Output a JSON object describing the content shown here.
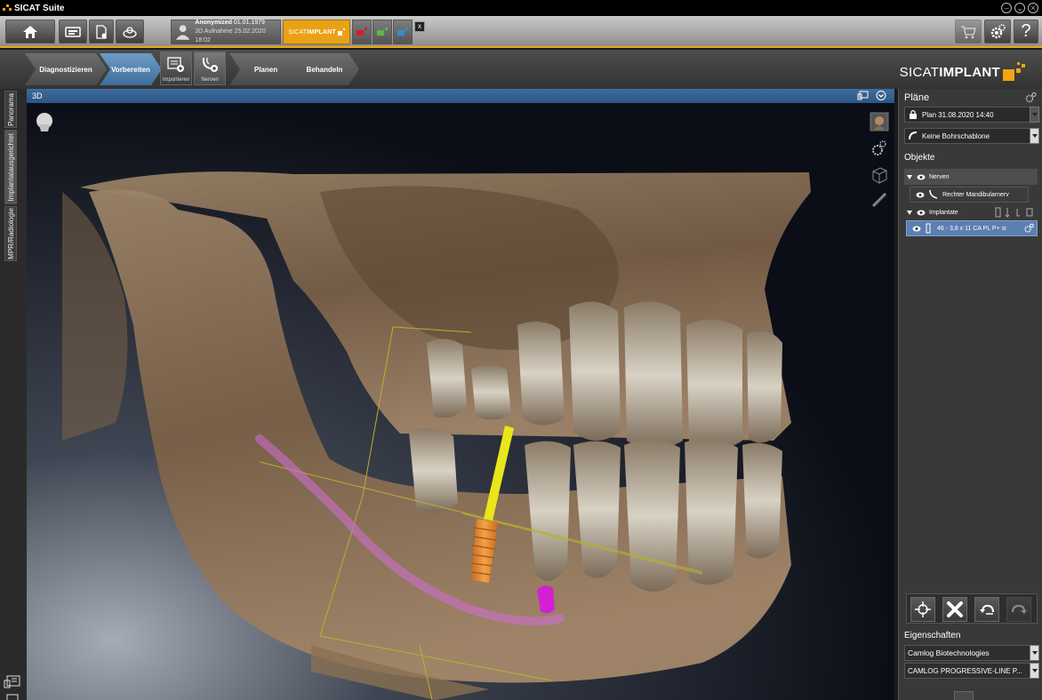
{
  "window": {
    "title": "SICAT Suite"
  },
  "study": {
    "patient_name": "Anonymized",
    "patient_dob": "01.01.1979",
    "scan_label": "3D Aufnahme",
    "scan_date": "25.02.2020 18:02"
  },
  "app_tab": {
    "prefix": "SICAT",
    "name": "IMPLANT"
  },
  "workflow": {
    "steps": [
      {
        "label": "Diagnostizieren"
      },
      {
        "label": "Vorbereiten"
      },
      {
        "label": "Planen"
      },
      {
        "label": "Behandeln"
      }
    ],
    "substeps": [
      {
        "label": "Importieren"
      },
      {
        "label": "Nerven"
      }
    ]
  },
  "brand": {
    "prefix": "SICAT",
    "name": "IMPLANT"
  },
  "left_tabs": [
    {
      "label": "Panorama"
    },
    {
      "label": "Implantatausgerichtet"
    },
    {
      "label": "MPR/Radiologie"
    }
  ],
  "view": {
    "title": "3D"
  },
  "right_panel": {
    "plans_heading": "Pläne",
    "plan": "Plan 31.08.2020 14:40",
    "guide": "Keine Bohrschablone",
    "objects_heading": "Objekte",
    "objects": {
      "nerves_group": "Nerven",
      "nerve_item": "Rechter Mandibularnerv",
      "implants_group": "Implantate",
      "implant_item": "46 - 3,8 x 11 CA PL P+ si"
    },
    "properties_heading": "Eigenschaften",
    "manufacturer": "Camlog Biotechnologies",
    "product_line": "CAMLOG PROGRESSIVE-LINE P..."
  },
  "colors": {
    "accent": "#f0a60c",
    "active_step": "#4d7fb1",
    "selected_row": "#5b7fb2",
    "implant": "#e9e61a",
    "implant_body": "#e88a2a",
    "nerve": "#d46ed6"
  }
}
